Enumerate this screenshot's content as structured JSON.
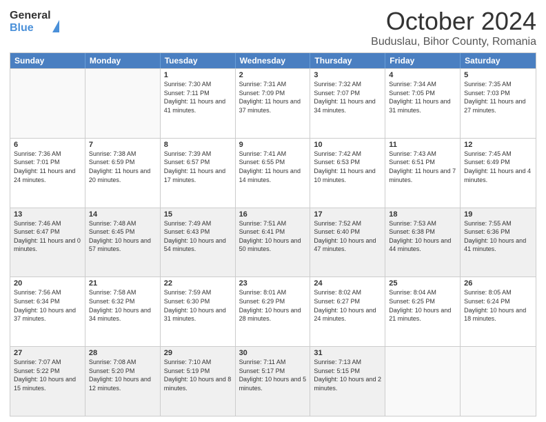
{
  "logo": {
    "general": "General",
    "blue": "Blue"
  },
  "title": {
    "month_year": "October 2024",
    "location": "Buduslau, Bihor County, Romania"
  },
  "header_days": [
    "Sunday",
    "Monday",
    "Tuesday",
    "Wednesday",
    "Thursday",
    "Friday",
    "Saturday"
  ],
  "weeks": [
    [
      {
        "day": "",
        "info": "",
        "shaded": true,
        "empty": true
      },
      {
        "day": "",
        "info": "",
        "shaded": true,
        "empty": true
      },
      {
        "day": "1",
        "info": "Sunrise: 7:30 AM\nSunset: 7:11 PM\nDaylight: 11 hours and 41 minutes."
      },
      {
        "day": "2",
        "info": "Sunrise: 7:31 AM\nSunset: 7:09 PM\nDaylight: 11 hours and 37 minutes."
      },
      {
        "day": "3",
        "info": "Sunrise: 7:32 AM\nSunset: 7:07 PM\nDaylight: 11 hours and 34 minutes."
      },
      {
        "day": "4",
        "info": "Sunrise: 7:34 AM\nSunset: 7:05 PM\nDaylight: 11 hours and 31 minutes."
      },
      {
        "day": "5",
        "info": "Sunrise: 7:35 AM\nSunset: 7:03 PM\nDaylight: 11 hours and 27 minutes."
      }
    ],
    [
      {
        "day": "6",
        "info": "Sunrise: 7:36 AM\nSunset: 7:01 PM\nDaylight: 11 hours and 24 minutes."
      },
      {
        "day": "7",
        "info": "Sunrise: 7:38 AM\nSunset: 6:59 PM\nDaylight: 11 hours and 20 minutes."
      },
      {
        "day": "8",
        "info": "Sunrise: 7:39 AM\nSunset: 6:57 PM\nDaylight: 11 hours and 17 minutes."
      },
      {
        "day": "9",
        "info": "Sunrise: 7:41 AM\nSunset: 6:55 PM\nDaylight: 11 hours and 14 minutes."
      },
      {
        "day": "10",
        "info": "Sunrise: 7:42 AM\nSunset: 6:53 PM\nDaylight: 11 hours and 10 minutes."
      },
      {
        "day": "11",
        "info": "Sunrise: 7:43 AM\nSunset: 6:51 PM\nDaylight: 11 hours and 7 minutes."
      },
      {
        "day": "12",
        "info": "Sunrise: 7:45 AM\nSunset: 6:49 PM\nDaylight: 11 hours and 4 minutes."
      }
    ],
    [
      {
        "day": "13",
        "info": "Sunrise: 7:46 AM\nSunset: 6:47 PM\nDaylight: 11 hours and 0 minutes.",
        "shaded": true
      },
      {
        "day": "14",
        "info": "Sunrise: 7:48 AM\nSunset: 6:45 PM\nDaylight: 10 hours and 57 minutes.",
        "shaded": true
      },
      {
        "day": "15",
        "info": "Sunrise: 7:49 AM\nSunset: 6:43 PM\nDaylight: 10 hours and 54 minutes.",
        "shaded": true
      },
      {
        "day": "16",
        "info": "Sunrise: 7:51 AM\nSunset: 6:41 PM\nDaylight: 10 hours and 50 minutes.",
        "shaded": true
      },
      {
        "day": "17",
        "info": "Sunrise: 7:52 AM\nSunset: 6:40 PM\nDaylight: 10 hours and 47 minutes.",
        "shaded": true
      },
      {
        "day": "18",
        "info": "Sunrise: 7:53 AM\nSunset: 6:38 PM\nDaylight: 10 hours and 44 minutes.",
        "shaded": true
      },
      {
        "day": "19",
        "info": "Sunrise: 7:55 AM\nSunset: 6:36 PM\nDaylight: 10 hours and 41 minutes.",
        "shaded": true
      }
    ],
    [
      {
        "day": "20",
        "info": "Sunrise: 7:56 AM\nSunset: 6:34 PM\nDaylight: 10 hours and 37 minutes."
      },
      {
        "day": "21",
        "info": "Sunrise: 7:58 AM\nSunset: 6:32 PM\nDaylight: 10 hours and 34 minutes."
      },
      {
        "day": "22",
        "info": "Sunrise: 7:59 AM\nSunset: 6:30 PM\nDaylight: 10 hours and 31 minutes."
      },
      {
        "day": "23",
        "info": "Sunrise: 8:01 AM\nSunset: 6:29 PM\nDaylight: 10 hours and 28 minutes."
      },
      {
        "day": "24",
        "info": "Sunrise: 8:02 AM\nSunset: 6:27 PM\nDaylight: 10 hours and 24 minutes."
      },
      {
        "day": "25",
        "info": "Sunrise: 8:04 AM\nSunset: 6:25 PM\nDaylight: 10 hours and 21 minutes."
      },
      {
        "day": "26",
        "info": "Sunrise: 8:05 AM\nSunset: 6:24 PM\nDaylight: 10 hours and 18 minutes."
      }
    ],
    [
      {
        "day": "27",
        "info": "Sunrise: 7:07 AM\nSunset: 5:22 PM\nDaylight: 10 hours and 15 minutes.",
        "shaded": true
      },
      {
        "day": "28",
        "info": "Sunrise: 7:08 AM\nSunset: 5:20 PM\nDaylight: 10 hours and 12 minutes.",
        "shaded": true
      },
      {
        "day": "29",
        "info": "Sunrise: 7:10 AM\nSunset: 5:19 PM\nDaylight: 10 hours and 8 minutes.",
        "shaded": true
      },
      {
        "day": "30",
        "info": "Sunrise: 7:11 AM\nSunset: 5:17 PM\nDaylight: 10 hours and 5 minutes.",
        "shaded": true
      },
      {
        "day": "31",
        "info": "Sunrise: 7:13 AM\nSunset: 5:15 PM\nDaylight: 10 hours and 2 minutes.",
        "shaded": true
      },
      {
        "day": "",
        "info": "",
        "shaded": true,
        "empty": true
      },
      {
        "day": "",
        "info": "",
        "shaded": true,
        "empty": true
      }
    ]
  ]
}
